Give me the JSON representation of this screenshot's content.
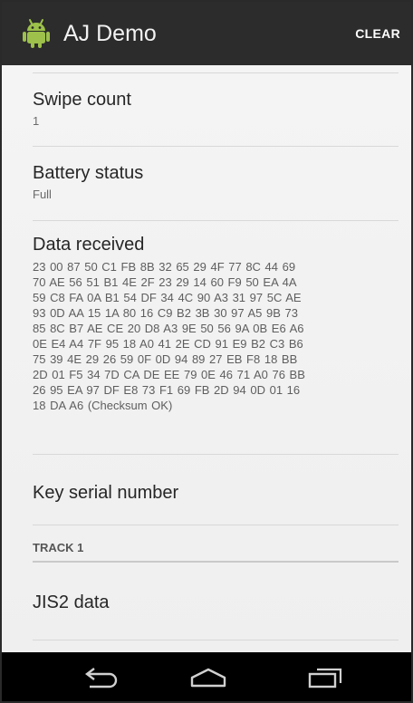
{
  "action_bar": {
    "title": "AJ Demo",
    "clear_label": "CLEAR",
    "icon": "android-robot-icon"
  },
  "items": [
    {
      "title": "Swipe count",
      "value": "1"
    },
    {
      "title": "Battery status",
      "value": "Full"
    },
    {
      "title": "Data received",
      "value": "23 00 87 50 C1 FB 8B 32 65 29 4F 77 8C 44 69\n70 AE 56 51 B1 4E 2F 23 29 14 60 F9 50 EA 4A\n59 C8 FA 0A B1 54 DF 34 4C 90 A3 31 97 5C AE\n93 0D AA 15 1A 80 16 C9 B2 3B 30 97 A5 9B 73\n85 8C B7 AE CE 20 D8 A3 9E 50 56 9A 0B E6 A6\n0E E4 A4 7F 95 18 A0 41 2E CD 91 E9 B2 C3 B6\n75 39 4E 29 26 59 0F 0D 94 89 27 EB F8 18 BB\n2D 01 F5 34 7D CA DE EE 79 0E 46 71 A0 76 BB\n26 95 EA 97 DF E8 73 F1 69 FB 2D 94 0D 01 16\n18 DA A6  (Checksum OK)"
    },
    {
      "title": "Key serial number"
    }
  ],
  "section": {
    "label": "TRACK 1"
  },
  "track_items": [
    {
      "title": "JIS2 data"
    }
  ],
  "nav": {
    "back_icon": "back-icon",
    "home_icon": "home-icon",
    "recents_icon": "recents-icon"
  },
  "colors": {
    "action_bar": "#2c2c2c",
    "android_green": "#9dc14a",
    "background": "#f3f3f3",
    "nav_bar": "#000000"
  }
}
